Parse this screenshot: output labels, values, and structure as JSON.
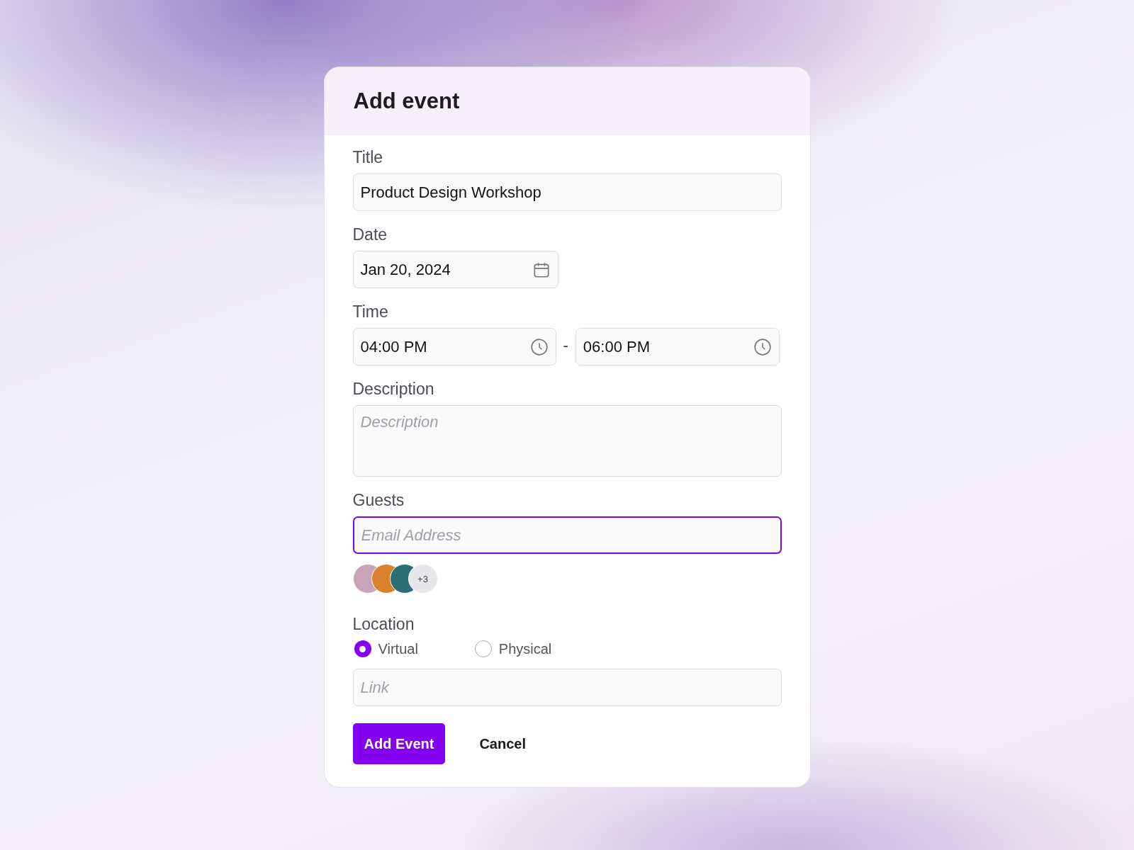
{
  "dialog": {
    "title": "Add event"
  },
  "title_field": {
    "label": "Title",
    "value": "Product Design Workshop"
  },
  "date_field": {
    "label": "Date",
    "value": "Jan 20, 2024"
  },
  "time_field": {
    "label": "Time",
    "start": "04:00 PM",
    "separator": "-",
    "end": "06:00 PM"
  },
  "description_field": {
    "label": "Description",
    "placeholder": "Description"
  },
  "guests_field": {
    "label": "Guests",
    "placeholder": "Email Address",
    "focused": true,
    "avatars": [
      {
        "color": "#c9a3b8"
      },
      {
        "color": "#d9822b"
      },
      {
        "color": "#2a6f73"
      }
    ],
    "more": "+3"
  },
  "location_field": {
    "label": "Location",
    "options": [
      {
        "label": "Virtual",
        "selected": true
      },
      {
        "label": "Physical",
        "selected": false
      }
    ],
    "link_placeholder": "Link"
  },
  "buttons": [
    {
      "label": "Add Event",
      "kind": "primary"
    },
    {
      "label": "Cancel",
      "kind": "plain"
    }
  ]
}
